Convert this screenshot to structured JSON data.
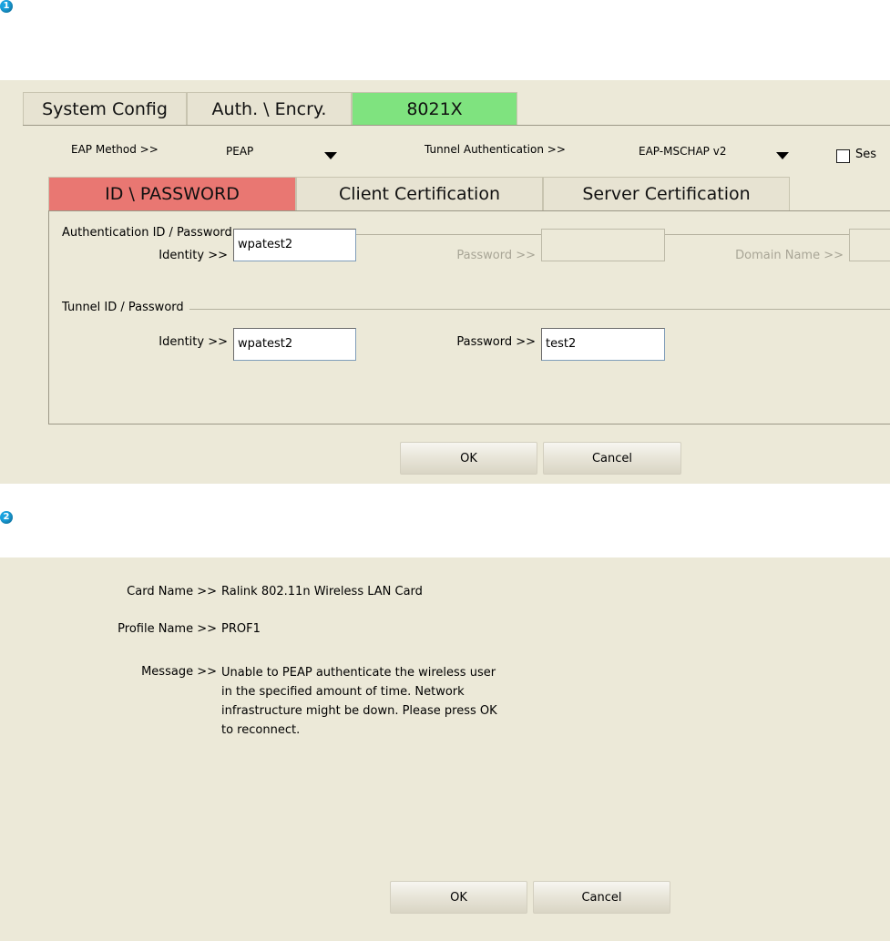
{
  "markers": {
    "first": "1",
    "second": "2"
  },
  "top_tabs": [
    {
      "label": "System Config"
    },
    {
      "label": "Auth. \\ Encry."
    },
    {
      "label": "8021X"
    }
  ],
  "eap": {
    "method_label": "EAP Method >>",
    "method_value": "PEAP",
    "tunnel_label": "Tunnel Authentication >>",
    "tunnel_value": "EAP-MSCHAP v2",
    "session_label": "Ses"
  },
  "sub_tabs": [
    {
      "label": "ID \\ PASSWORD"
    },
    {
      "label": "Client Certification"
    },
    {
      "label": "Server Certification"
    }
  ],
  "auth_group": {
    "legend": "Authentication ID / Password",
    "identity_label": "Identity >>",
    "identity_value": "wpatest2",
    "password_label": "Password >>",
    "password_value": "",
    "domain_label": "Domain Name >>",
    "domain_value": ""
  },
  "tunnel_group": {
    "legend": "Tunnel ID / Password",
    "identity_label": "Identity >>",
    "identity_value": "wpatest2",
    "password_label": "Password >>",
    "password_value": "test2"
  },
  "dialog1_buttons": {
    "ok": "OK",
    "cancel": "Cancel"
  },
  "status": {
    "card_label": "Card Name >>",
    "card_value": "Ralink 802.11n Wireless LAN Card",
    "profile_label": "Profile Name >>",
    "profile_value": "PROF1",
    "message_label": "Message >>",
    "message_value": "Unable to PEAP authenticate the wireless user in the specified amount of time. Network infrastructure might be down. Please press OK to reconnect."
  },
  "dialog2_buttons": {
    "ok": "OK",
    "cancel": "Cancel"
  }
}
